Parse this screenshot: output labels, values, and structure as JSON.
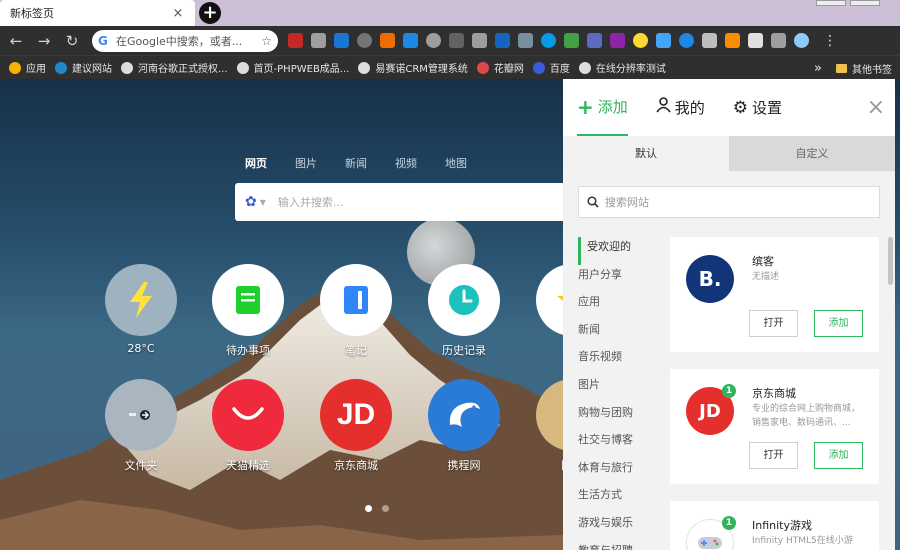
{
  "browser": {
    "tab_title": "新标签页",
    "tab_close": "×",
    "new_tab": "+",
    "omnibox_text": "在Google中搜索，或者...",
    "omnibox_g": "G",
    "bookmarks": [
      {
        "label": "应用",
        "color": "#f4b400"
      },
      {
        "label": "建议网站",
        "color": "#1f8ac9"
      },
      {
        "label": "河南谷歌正式授权...",
        "color": "#dddddd"
      },
      {
        "label": "首页-PHPWEB成品...",
        "color": "#dddddd"
      },
      {
        "label": "易赛诺CRM管理系统",
        "color": "#dddddd"
      },
      {
        "label": "花瓣网",
        "color": "#e0464b"
      },
      {
        "label": "百度",
        "color": "#3b5bdb"
      },
      {
        "label": "在线分辨率测试",
        "color": "#dddddd"
      }
    ],
    "bookmarks_more": "»",
    "other_bookmarks": "其他书签"
  },
  "newtab": {
    "search_tabs": [
      "网页",
      "图片",
      "新闻",
      "视频",
      "地图"
    ],
    "search_placeholder": "输入并搜索...",
    "apps": [
      {
        "label": "28°C",
        "bg": "#9eb2bf"
      },
      {
        "label": "待办事项",
        "bg": "#ffffff"
      },
      {
        "label": "笔记",
        "bg": "#ffffff"
      },
      {
        "label": "历史记录",
        "bg": "#ffffff"
      },
      {
        "label": "文件夹",
        "bg": "#aab6bf"
      },
      {
        "label": "天猫精选",
        "bg": "#ef2a3c"
      },
      {
        "label": "京东商城",
        "bg": "#e52f2c"
      },
      {
        "label": "携程网",
        "bg": "#2a7bd6"
      },
      {
        "label": "网易",
        "bg": "#d9b880"
      }
    ]
  },
  "panel": {
    "tabs": [
      {
        "label": "添加",
        "icon": "+"
      },
      {
        "label": "我的",
        "icon": "user-icon"
      },
      {
        "label": "设置",
        "icon": "gear-icon"
      }
    ],
    "close": "×",
    "segments": [
      "默认",
      "自定义"
    ],
    "search_placeholder": "搜索网站",
    "categories": [
      "受欢迎的",
      "用户分享",
      "应用",
      "新闻",
      "音乐视频",
      "图片",
      "购物与团购",
      "社交与博客",
      "体育与旅行",
      "生活方式",
      "游戏与娱乐",
      "教育与招聘"
    ],
    "sites": [
      {
        "name": "缤客",
        "desc": "无描述",
        "logo_text": "B.",
        "logo_color": "#12357a",
        "badge": ""
      },
      {
        "name": "京东商城",
        "desc": "专业的综合网上购物商城，销售家电、数码通讯、...",
        "logo_text": "JD",
        "logo_color": "#e52f2c",
        "badge": "1"
      },
      {
        "name": "Infinity游戏",
        "desc": "Infinity HTML5在线小游",
        "logo_text": "",
        "logo_color": "#ffffff",
        "badge": "1"
      }
    ],
    "btn_open": "打开",
    "btn_add": "添加"
  }
}
